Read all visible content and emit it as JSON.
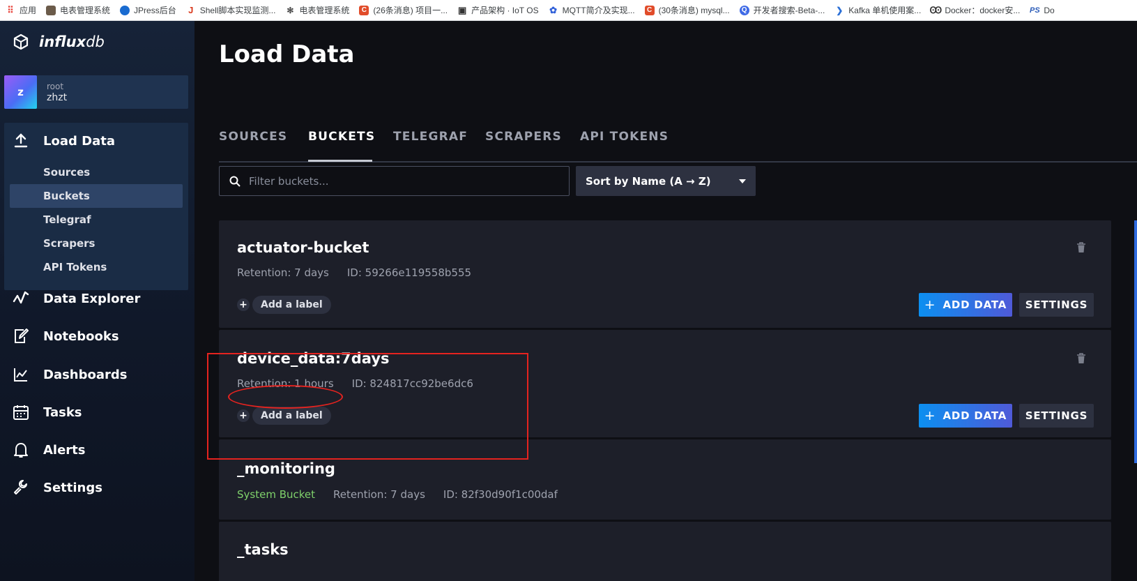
{
  "bookmarks": [
    {
      "label": "应用",
      "icon": "apps-grid-icon",
      "color": "#e8453c"
    },
    {
      "label": "电表管理系统",
      "icon": "site-favicon",
      "color": "#6b5b4a"
    },
    {
      "label": "JPress后台",
      "icon": "globe-icon",
      "color": "#1a6bd0"
    },
    {
      "label": "Shell脚本实现监测...",
      "icon": "jianshu-icon",
      "color": "#d9391c"
    },
    {
      "label": "电表管理系统",
      "icon": "leaf-icon",
      "color": "#4a4a4a"
    },
    {
      "label": "(26条消息) 项目一...",
      "icon": "csdn-icon",
      "color": "#e14c2a"
    },
    {
      "label": "产品架构 · IoT OS",
      "icon": "book-icon",
      "color": "#333333"
    },
    {
      "label": "MQTT简介及实现...",
      "icon": "baidu-paw-icon",
      "color": "#2f5fd8"
    },
    {
      "label": "(30条消息) mysql...",
      "icon": "csdn-icon",
      "color": "#e14c2a"
    },
    {
      "label": "开发者搜索-Beta-...",
      "icon": "search-q-icon",
      "color": "#3f6ae6"
    },
    {
      "label": "Kafka 单机使用案...",
      "icon": "chevron-logo-icon",
      "color": "#2a6fd6"
    },
    {
      "label": "Docker：docker安...",
      "icon": "docker-icon",
      "color": "#333333"
    },
    {
      "label": "Do",
      "icon": "ps-icon",
      "color": "#2a5bb8"
    }
  ],
  "brand": {
    "bold": "influx",
    "light": "db"
  },
  "user": {
    "initial": "z",
    "org": "root",
    "name": "zhzt"
  },
  "sidebar": {
    "load_data": "Load Data",
    "sub_items": [
      "Sources",
      "Buckets",
      "Telegraf",
      "Scrapers",
      "API Tokens"
    ],
    "items": [
      "Data Explorer",
      "Notebooks",
      "Dashboards",
      "Tasks",
      "Alerts",
      "Settings"
    ]
  },
  "page": {
    "title": "Load Data",
    "tabs": [
      "SOURCES",
      "BUCKETS",
      "TELEGRAF",
      "SCRAPERS",
      "API TOKENS"
    ],
    "active_tab": "BUCKETS"
  },
  "toolbar": {
    "search_placeholder": "Filter buckets...",
    "sort_label": "Sort by Name (A → Z)"
  },
  "buckets": [
    {
      "name": "actuator-bucket",
      "retention": "Retention: 7 days",
      "id": "ID: 59266e119558b555",
      "add_label": "Add a label",
      "add_data": "ADD DATA",
      "settings": "SETTINGS"
    },
    {
      "name": "device_data:7days",
      "retention": "Retention: 1 hours",
      "id": "ID: 824817cc92be6dc6",
      "add_label": "Add a label",
      "add_data": "ADD DATA",
      "settings": "SETTINGS"
    },
    {
      "name": "_monitoring",
      "system": "System Bucket",
      "retention": "Retention: 7 days",
      "id": "ID: 82f30d90f1c00daf"
    },
    {
      "name": "_tasks"
    }
  ],
  "colors": {
    "accent_blue": "#0c8ff0",
    "accent_purple": "#4f5ad8",
    "annotation_red": "#e5231f",
    "system_green": "#7fd16b"
  }
}
